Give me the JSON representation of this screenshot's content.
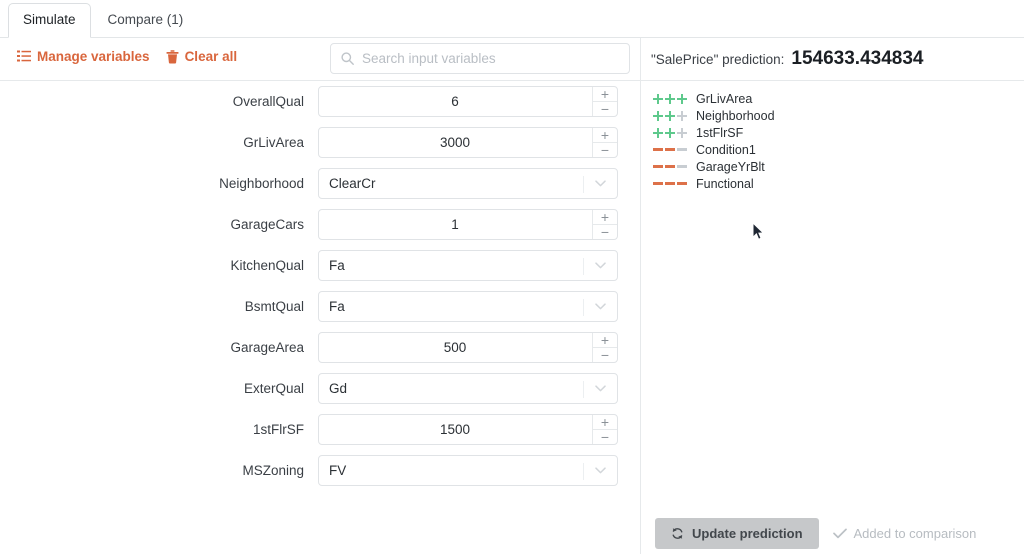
{
  "tabs": [
    {
      "label": "Simulate",
      "active": true
    },
    {
      "label": "Compare (1)",
      "active": false
    }
  ],
  "toolbar": {
    "manage_variables_label": "Manage variables",
    "manage_variables_icon": "list-icon",
    "clear_all_label": "Clear all",
    "clear_all_icon": "trash-icon",
    "accent_color": "#d9663d"
  },
  "search": {
    "placeholder": "Search input variables",
    "value": "",
    "icon": "search-icon"
  },
  "form": {
    "fields": [
      {
        "label": "OverallQual",
        "type": "number",
        "value": "6"
      },
      {
        "label": "GrLivArea",
        "type": "number",
        "value": "3000"
      },
      {
        "label": "Neighborhood",
        "type": "select",
        "value": "ClearCr"
      },
      {
        "label": "GarageCars",
        "type": "number",
        "value": "1"
      },
      {
        "label": "KitchenQual",
        "type": "select",
        "value": "Fa"
      },
      {
        "label": "BsmtQual",
        "type": "select",
        "value": "Fa"
      },
      {
        "label": "GarageArea",
        "type": "number",
        "value": "500"
      },
      {
        "label": "ExterQual",
        "type": "select",
        "value": "Gd"
      },
      {
        "label": "1stFlrSF",
        "type": "number",
        "value": "1500"
      },
      {
        "label": "MSZoning",
        "type": "select",
        "value": "FV"
      }
    ],
    "stepper_increment_label": "+",
    "stepper_decrement_label": "−",
    "chevron_icon": "chevron-down-icon"
  },
  "prediction": {
    "label": "\"SalePrice\" prediction:",
    "value": "154633.434834"
  },
  "features": {
    "positive_color": "#5ec98c",
    "negative_color": "#dd7149",
    "inactive_color": "#c8cdd2",
    "items": [
      {
        "name": "GrLivArea",
        "direction": "positive",
        "strength": 3
      },
      {
        "name": "Neighborhood",
        "direction": "positive",
        "strength": 2
      },
      {
        "name": "1stFlrSF",
        "direction": "positive",
        "strength": 2
      },
      {
        "name": "Condition1",
        "direction": "negative",
        "strength": 2
      },
      {
        "name": "GarageYrBlt",
        "direction": "negative",
        "strength": 2
      },
      {
        "name": "Functional",
        "direction": "negative",
        "strength": 3
      }
    ]
  },
  "footer": {
    "update_label": "Update prediction",
    "update_icon": "refresh-icon",
    "added_label": "Added to comparison",
    "added_icon": "check-icon"
  }
}
